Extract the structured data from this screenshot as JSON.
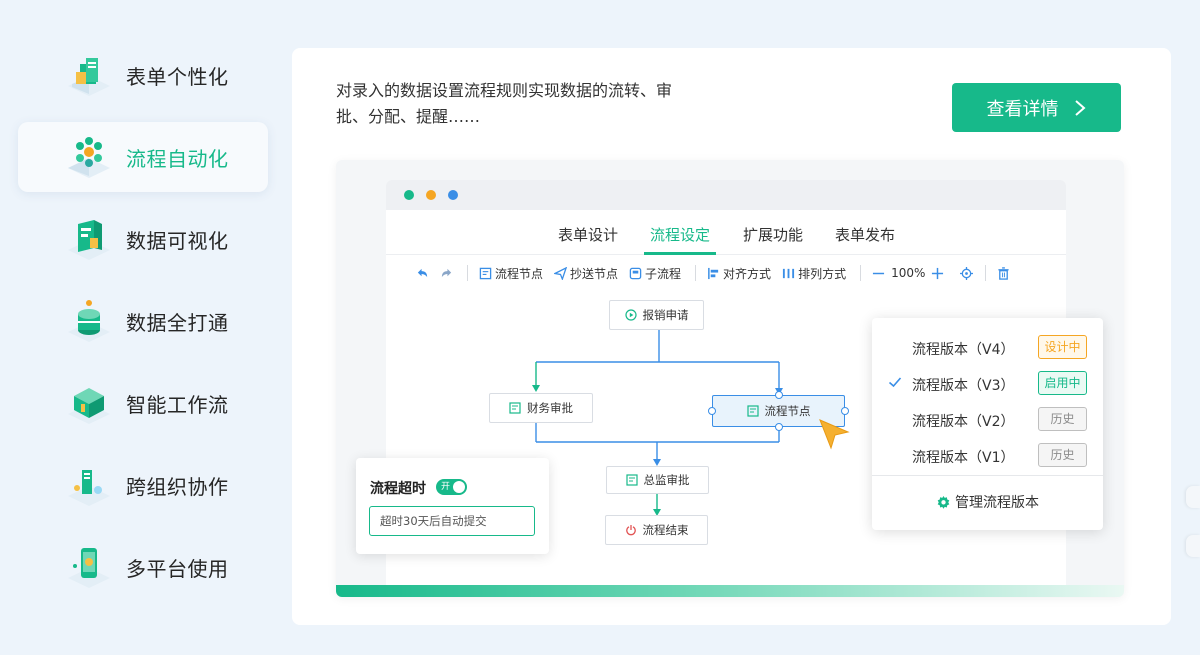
{
  "sidebar": {
    "items": [
      {
        "label": "表单个性化",
        "icon": "form-cube-icon"
      },
      {
        "label": "流程自动化",
        "icon": "flow-hexagon-icon",
        "active": true
      },
      {
        "label": "数据可视化",
        "icon": "chart-cube-icon"
      },
      {
        "label": "数据全打通",
        "icon": "database-cylinder-icon"
      },
      {
        "label": "智能工作流",
        "icon": "workflow-box-icon"
      },
      {
        "label": "跨组织协作",
        "icon": "collaboration-icon"
      },
      {
        "label": "多平台使用",
        "icon": "multi-device-icon"
      }
    ]
  },
  "main": {
    "description": "对录入的数据设置流程规则实现数据的流转、审批、分配、提醒……",
    "detail_button": "查看详情"
  },
  "preview": {
    "window_dots": [
      "#17b98a",
      "#f5a623",
      "#3a8ee6"
    ],
    "tabs": [
      {
        "label": "表单设计"
      },
      {
        "label": "流程设定",
        "active": true
      },
      {
        "label": "扩展功能"
      },
      {
        "label": "表单发布"
      }
    ],
    "toolbar": {
      "undo_icon": "undo-icon",
      "redo_icon": "redo-icon",
      "flow_node": "流程节点",
      "cc_node": "抄送节点",
      "sub_flow": "子流程",
      "align": "对齐方式",
      "arrange": "排列方式",
      "zoom": "100%"
    },
    "nodes": {
      "start": "报销申请",
      "finance": "财务审批",
      "flow_node": "流程节点",
      "director": "总监审批",
      "end": "流程结束"
    },
    "timeout": {
      "title": "流程超时",
      "toggle": "开",
      "input_value": "超时30天后自动提交"
    },
    "versions": [
      {
        "name": "流程版本（V4）",
        "status": "设计中",
        "color": "#f5a623",
        "bg": "#fff8ea"
      },
      {
        "name": "流程版本（V3）",
        "status": "启用中",
        "color": "#17b98a",
        "bg": "#eafaf4",
        "checked": true
      },
      {
        "name": "流程版本（V2）",
        "status": "历史",
        "color": "#8c8c8c",
        "bg": "#f5f5f5"
      },
      {
        "name": "流程版本（V1）",
        "status": "历史",
        "color": "#8c8c8c",
        "bg": "#f5f5f5"
      }
    ],
    "manage_label": "管理流程版本"
  },
  "colors": {
    "accent": "#17b98a",
    "blue": "#3a8ee6",
    "page_bg": "#edf4fb"
  }
}
